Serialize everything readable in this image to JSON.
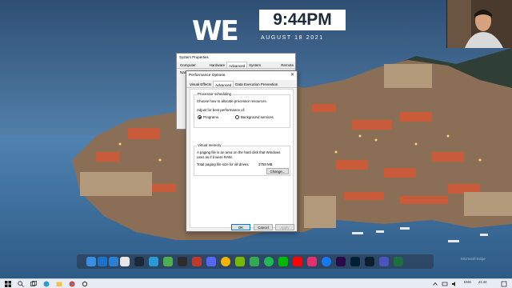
{
  "widget": {
    "logo": "WE",
    "time": "9:44PM",
    "date": "AUGUST 18 2021"
  },
  "system_properties": {
    "title": "System Properties",
    "tabs": [
      "Computer Name",
      "Hardware",
      "Advanced",
      "System Protection",
      "Remote"
    ]
  },
  "performance_options": {
    "title": "Performance Options",
    "tabs": [
      "Visual Effects",
      "Advanced",
      "Data Execution Prevention"
    ],
    "processor_scheduling": {
      "legend": "Processor scheduling",
      "description": "Choose how to allocate processor resources.",
      "adjust_label": "Adjust for best performance of:",
      "options": [
        "Programs",
        "Background services"
      ],
      "selected": "Programs"
    },
    "virtual_memory": {
      "legend": "Virtual memory",
      "description": "A paging file is an area on the hard disk that Windows uses as if it were RAM.",
      "total_label": "Total paging file size for all drives:",
      "total_value": "3758 MB",
      "change_button": "Change..."
    },
    "buttons": {
      "ok": "OK",
      "cancel": "Cancel",
      "apply": "Apply"
    }
  },
  "taskbar": {
    "language": "ENG",
    "clock": "21:44",
    "watermark": "Microsoft Edge"
  },
  "colors": {
    "accent": "#0078d7",
    "taskbar_bg": "#e8edf3",
    "dialog_bg": "#f0f0f0"
  },
  "dock_icons": [
    "explorer-icon",
    "store-icon",
    "mail-icon",
    "calendar-icon",
    "steam-icon",
    "edge-icon",
    "game-icon",
    "terminal-icon",
    "media-icon",
    "discord-icon",
    "chrome-icon",
    "nvidia-icon",
    "maps-icon",
    "spotify-icon",
    "line-icon",
    "youtube-icon",
    "opera-icon",
    "facebook-icon",
    "premiere-icon",
    "photoshop-icon",
    "lightroom-icon",
    "teams-icon",
    "excel-icon"
  ]
}
